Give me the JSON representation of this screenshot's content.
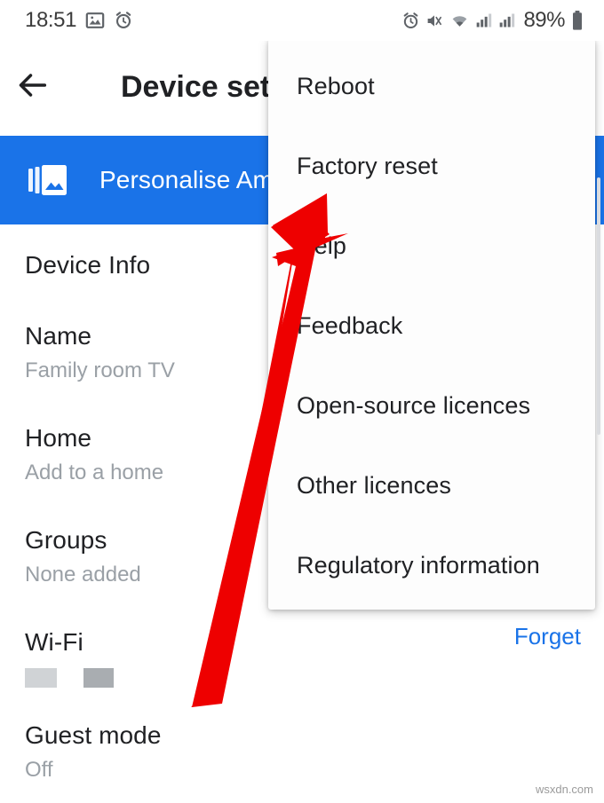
{
  "status_bar": {
    "time": "18:51",
    "battery_percent": "89%",
    "left_icons": [
      "image-icon",
      "alarm-icon"
    ],
    "right_icons": [
      "alarm-icon",
      "mute-vibrate-icon",
      "wifi-icon",
      "signal-icon-1",
      "signal-icon-2",
      "battery-icon"
    ]
  },
  "app_bar": {
    "back_icon": "arrow-left-icon",
    "title": "Device sett"
  },
  "banner": {
    "icon": "ambient-photos-icon",
    "label": "Personalise Amb",
    "color": "#1a73e8"
  },
  "list": {
    "section_header": "Device Info",
    "items": [
      {
        "title": "Name",
        "value": "Family room TV",
        "redacted": false
      },
      {
        "title": "Home",
        "value": "Add to a home",
        "redacted": false
      },
      {
        "title": "Groups",
        "value": "None added",
        "redacted": false
      },
      {
        "title": "Wi-Fi",
        "value": "",
        "redacted": true
      },
      {
        "title": "Guest mode",
        "value": "Off",
        "redacted": false
      }
    ],
    "forget_label": "Forget",
    "forget_color": "#1a73e8"
  },
  "menu": {
    "items": [
      {
        "label": "Reboot"
      },
      {
        "label": "Factory reset"
      },
      {
        "label": "Help"
      },
      {
        "label": "Feedback"
      },
      {
        "label": "Open-source licences"
      },
      {
        "label": "Other licences"
      },
      {
        "label": "Regulatory information"
      }
    ]
  },
  "annotation": {
    "arrow_color": "#ee0000",
    "points_to": "Factory reset"
  },
  "watermark": {
    "text": "wsxdn.com"
  }
}
